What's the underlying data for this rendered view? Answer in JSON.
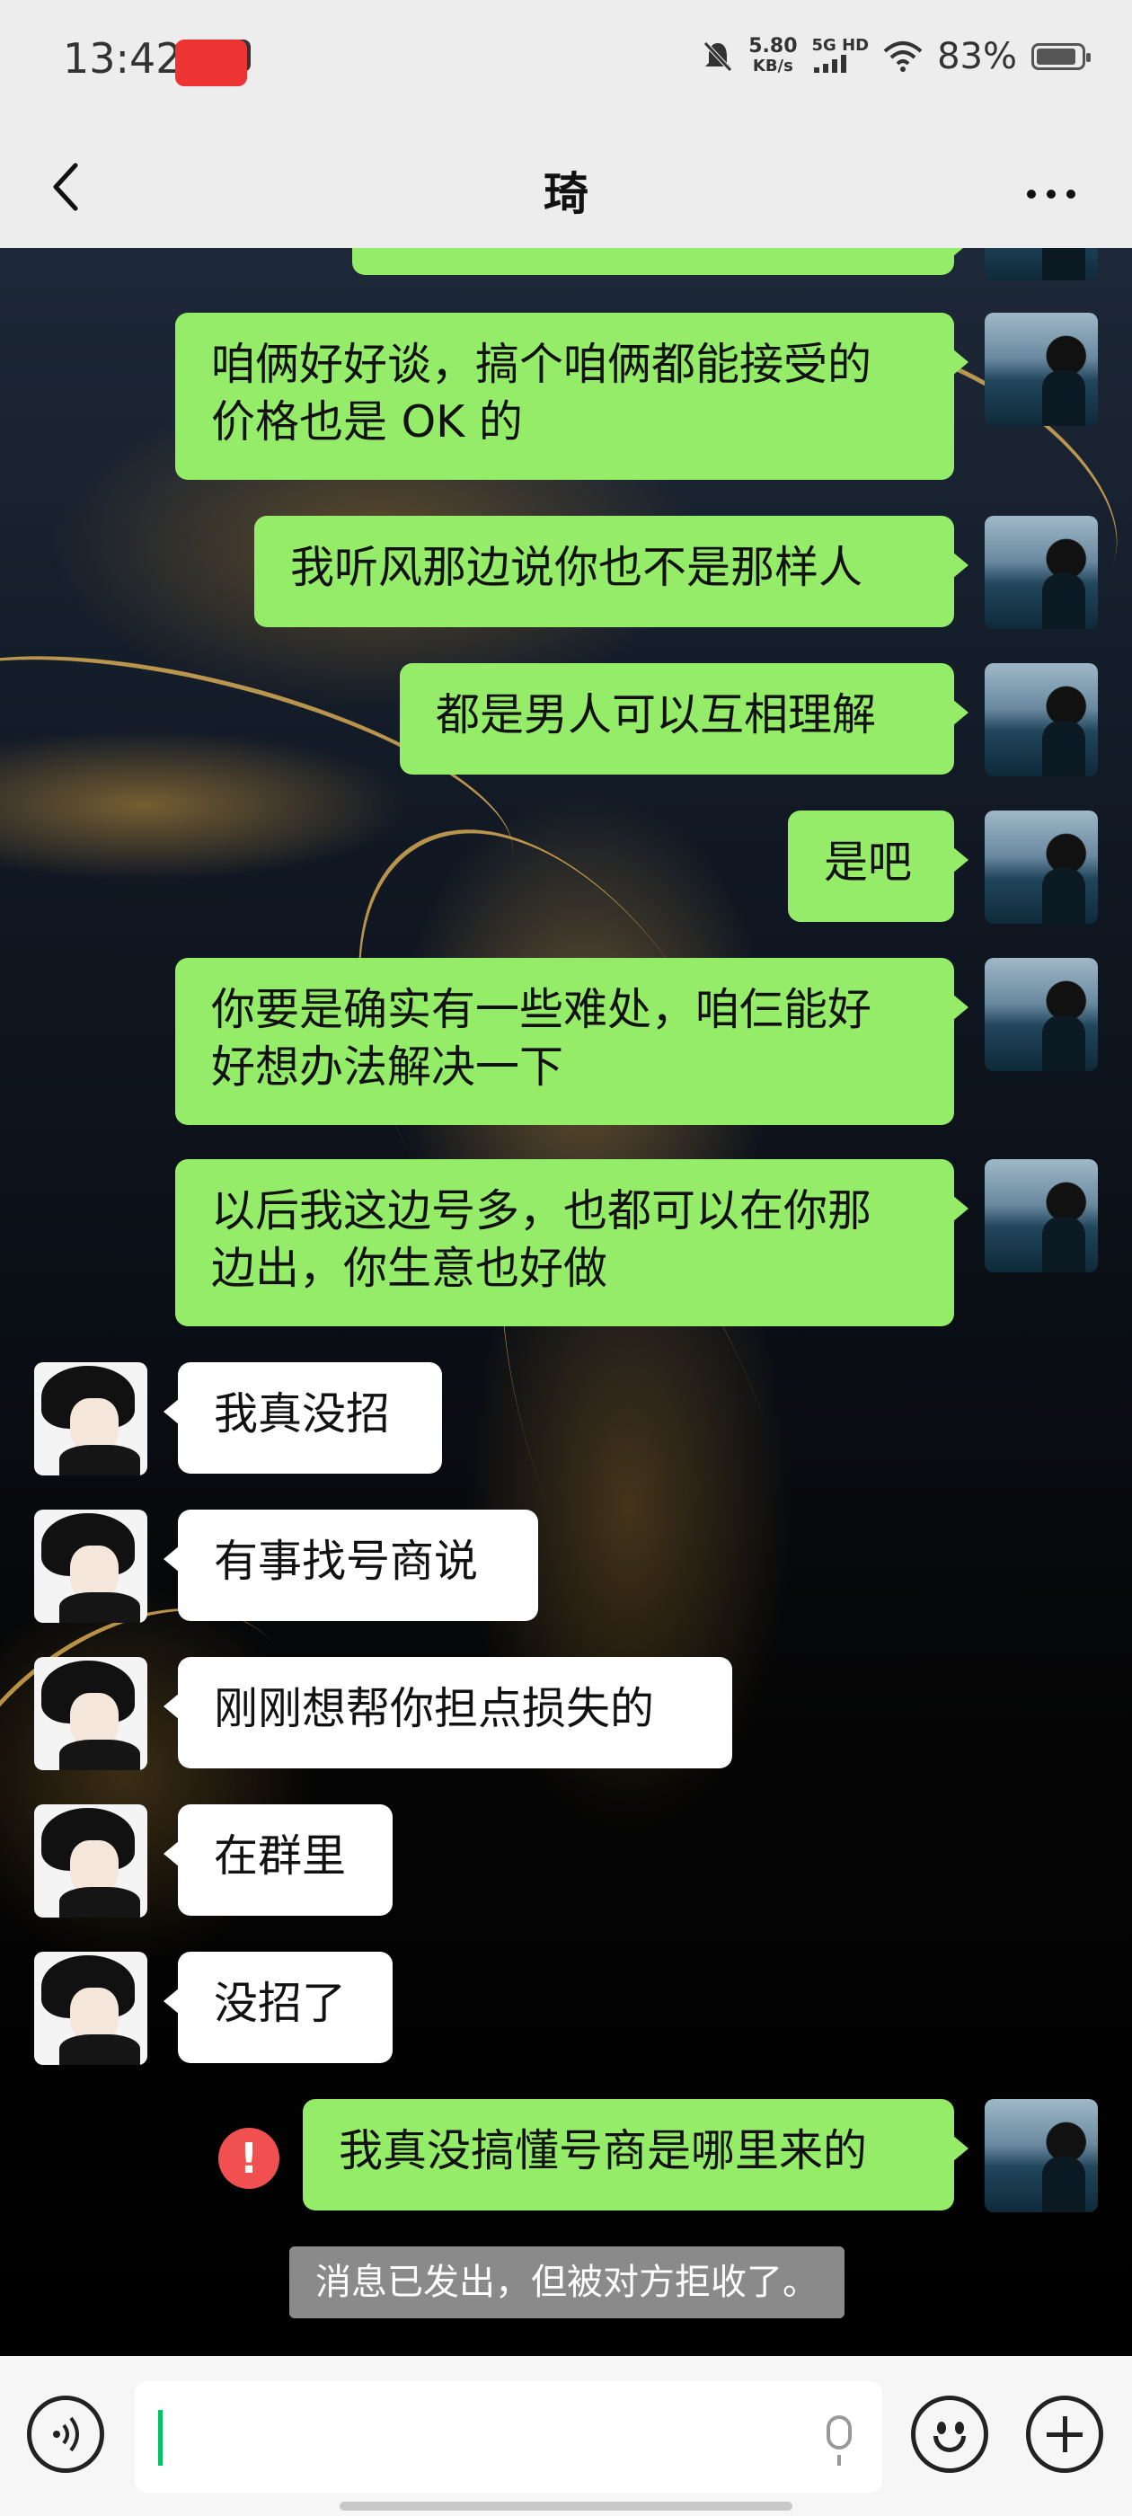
{
  "status_bar": {
    "time": "13:42",
    "net_speed_value": "5.80",
    "net_speed_unit": "KB/s",
    "network": "5G HD",
    "battery": "83%"
  },
  "header": {
    "title": "琦",
    "back_icon": "chevron-left-icon",
    "more_icon": "ellipsis-icon"
  },
  "messages": [
    {
      "from": "me",
      "text": "咱俩好好谈，搞个咱俩都能接受的\n价格也是 OK 的"
    },
    {
      "from": "me",
      "text": "我听风那边说你也不是那样人"
    },
    {
      "from": "me",
      "text": "都是男人可以互相理解"
    },
    {
      "from": "me",
      "text": "是吧"
    },
    {
      "from": "me",
      "text": "你要是确实有一些难处，咱仨能好\n好想办法解决一下"
    },
    {
      "from": "me",
      "text": "以后我这边号多，也都可以在你那\n边出，你生意也好做"
    },
    {
      "from": "them",
      "text": "我真没招"
    },
    {
      "from": "them",
      "text": "有事找号商说"
    },
    {
      "from": "them",
      "text": "刚刚想帮你担点损失的"
    },
    {
      "from": "them",
      "text": "在群里"
    },
    {
      "from": "them",
      "text": "没招了"
    },
    {
      "from": "me",
      "text": "我真没搞懂号商是哪里来的",
      "status": "rejected"
    }
  ],
  "system_notice": "消息已发出，但被对方拒收了。",
  "error_mark": "!",
  "input_bar": {
    "voice_icon": "voice-mode-icon",
    "mic_icon": "microphone-icon",
    "emoji_icon": "emoji-icon",
    "plus_icon": "plus-icon",
    "value": ""
  },
  "colors": {
    "my_bubble": "#95ec69",
    "their_bubble": "#ffffff",
    "bar_background": "#ededed",
    "error": "#f05050"
  }
}
